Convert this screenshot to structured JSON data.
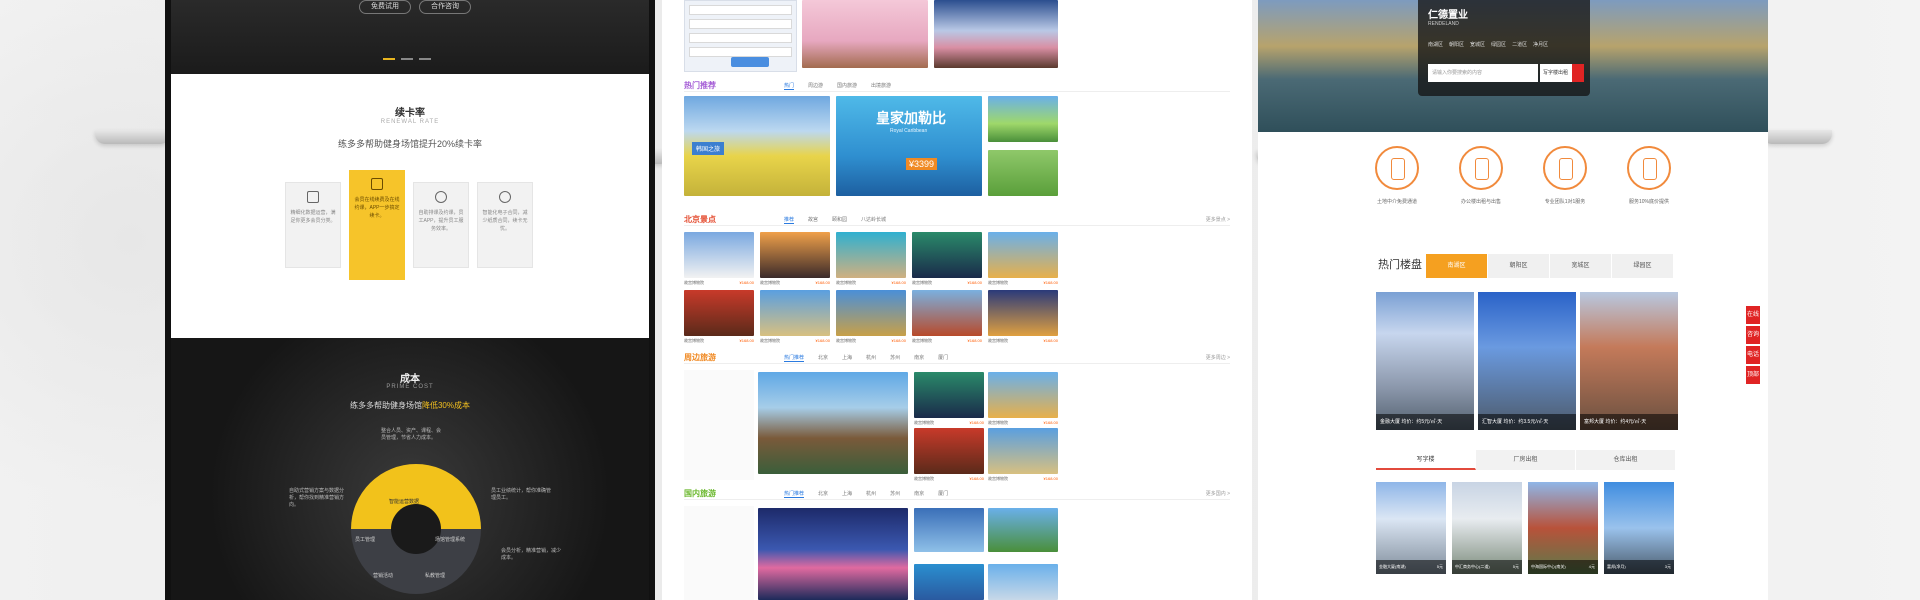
{
  "screen1": {
    "hero_buttons": [
      "免费试用",
      "合作咨询"
    ],
    "renewal": {
      "title": "续卡率",
      "en": "RENEWAL RATE",
      "subtitle": "练多多帮助健身场馆提升20%续卡率",
      "cards": [
        "精细化数据运营，满足你更多会员分类。",
        "会员在线续费及在线约课，APP一步搞定续卡。",
        "自助排课及约课，员工APP，提升员工服务效率。",
        "智能化电子合同，减少纸质合同，续卡无忧。"
      ]
    },
    "cost": {
      "title": "成本",
      "en": "PRIME COST",
      "subtitle_prefix": "练多多帮助健身场馆",
      "subtitle_highlight": "降低30%成本",
      "wheel_labels": [
        "智能运营数据",
        "场馆管理系统",
        "员工管理",
        "营销活动",
        "私教管理"
      ],
      "side_notes": [
        "整合人员、资产、课程、会员管理，节省人力成本。",
        "自助式营销方案与数据分析，帮你找到精准营销方向。",
        "员工业绩统计，帮你准确管理员工。",
        "会员分析，精准营销，减少成本。"
      ]
    }
  },
  "screen2": {
    "sections": [
      {
        "title": "热门推荐",
        "color": "#a55ed6",
        "tabs": [
          "热门",
          "周边游",
          "国内旅游",
          "出境旅游"
        ]
      },
      {
        "title": "北京景点",
        "color": "#e44b2f",
        "tabs": [
          "推荐",
          "故宫",
          "颐和园",
          "八达岭长城"
        ],
        "more": "更多景点 >"
      },
      {
        "title": "周边旅游",
        "color": "#f08a24",
        "tabs": [
          "热门推荐",
          "北京",
          "上海",
          "杭州",
          "苏州",
          "南京",
          "厦门"
        ],
        "more": "更多周边 >"
      },
      {
        "title": "国内旅游",
        "color": "#6bb82e",
        "tabs": [
          "热门推荐",
          "北京",
          "上海",
          "杭州",
          "苏州",
          "南京",
          "厦门"
        ],
        "more": "更多国内 >"
      }
    ],
    "promo": {
      "cruise_title": "皇家加勒比",
      "cruise_sub": "Royal Caribbean",
      "cruise_price": "¥3399",
      "jeju_title": "韩国之旅"
    },
    "tile_caption": "故宫博物院",
    "tile_price": "¥168.00"
  },
  "screen3": {
    "brand": "仁德置业",
    "brand_en": "RENDELAND",
    "nav": [
      "南湖区",
      "朝阳区",
      "宽城区",
      "绿园区",
      "二道区",
      "净月区"
    ],
    "search_placeholder": "请输入你要搜索的内容",
    "search_select": "写字楼出租",
    "features": [
      "土地中介免费通道",
      "办公楼出租与出售",
      "专业团队1对1服务",
      "服务10%底价提供"
    ],
    "hot_title": "热门楼盘",
    "hot_tabs": [
      "南湖区",
      "朝阳区",
      "宽城区",
      "绿园区"
    ],
    "buildings": [
      "金融大厦 均价：约5元/㎡·天",
      "汇智大厦 均价：约3.5元/㎡·天",
      "富邦大厦 均价：约4元/㎡·天"
    ],
    "sec2_tabs": [
      "写字楼",
      "厂房出租",
      "仓库出租"
    ],
    "buildings2": [
      "金融大厦(南湖)",
      "中汇商务中心(二道)",
      "中海国际中心(南关)",
      "富邦(净月)"
    ],
    "buildings2_tags": [
      "5元",
      "5元",
      "4元",
      "3元"
    ],
    "float_bar": [
      "在线",
      "咨询",
      "电话",
      "顶部"
    ]
  }
}
